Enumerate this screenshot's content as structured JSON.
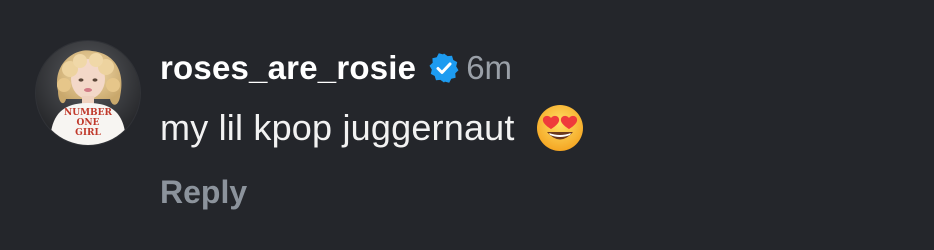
{
  "comment": {
    "username": "roses_are_rosie",
    "verified": true,
    "verified_icon": "verified-badge-icon",
    "timestamp": "6m",
    "text": "my lil kpop juggernaut",
    "emoji": "heart-eyes-emoji",
    "reply_label": "Reply",
    "avatar": {
      "shirt_text": [
        "NUMBER",
        "ONE",
        "GIRL"
      ]
    }
  },
  "colors": {
    "background": "#24262b",
    "username": "#ffffff",
    "timestamp": "#9aa0a8",
    "reply": "#8c939c",
    "verified": "#1d9bf0"
  }
}
